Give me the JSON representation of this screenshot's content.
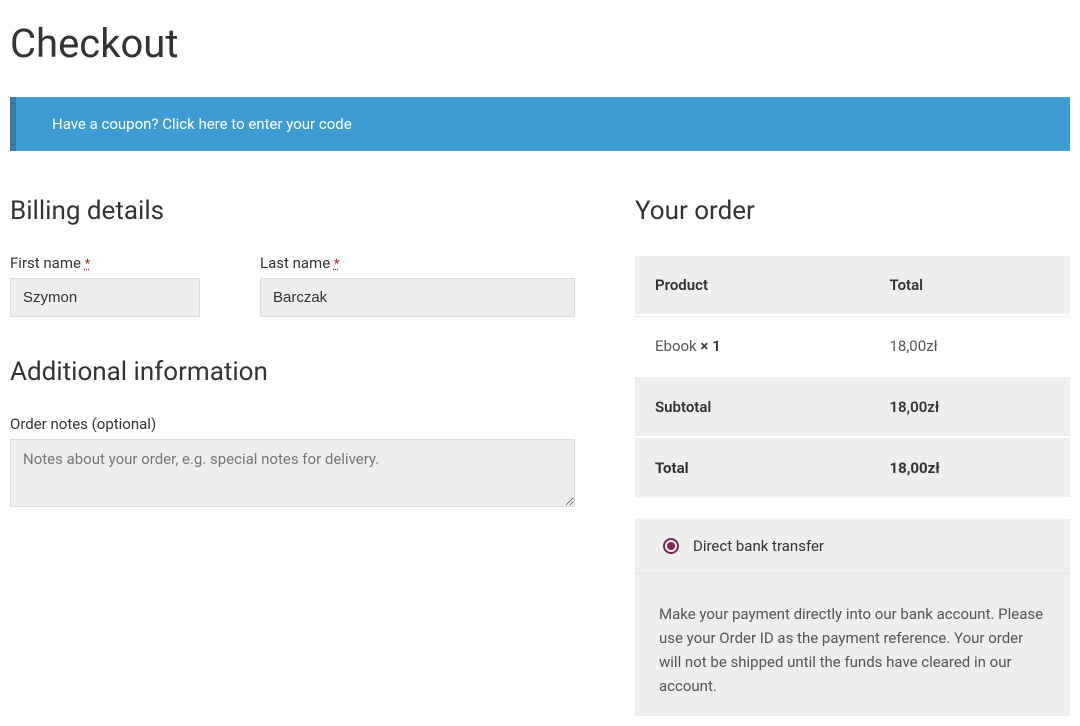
{
  "page": {
    "title": "Checkout"
  },
  "coupon": {
    "prompt": "Have a coupon? ",
    "link": "Click here to enter your code"
  },
  "billing": {
    "heading": "Billing details",
    "first_name_label": "First name ",
    "first_name_value": "Szymon",
    "last_name_label": "Last name ",
    "last_name_value": "Barczak",
    "required_mark": "*"
  },
  "additional": {
    "heading": "Additional information",
    "notes_label": "Order notes (optional)",
    "notes_placeholder": "Notes about your order, e.g. special notes for delivery.",
    "notes_value": ""
  },
  "order": {
    "heading": "Your order",
    "headers": {
      "product": "Product",
      "total": "Total"
    },
    "items": [
      {
        "name": "Ebook ",
        "qty": " × 1",
        "price": "18,00zł"
      }
    ],
    "subtotal_label": "Subtotal",
    "subtotal_value": "18,00zł",
    "total_label": "Total",
    "total_value": "18,00zł"
  },
  "payment": {
    "method_label": "Direct bank transfer",
    "description": "Make your payment directly into our bank account. Please use your Order ID as the payment reference. Your order will not be shipped until the funds have cleared in our account."
  }
}
